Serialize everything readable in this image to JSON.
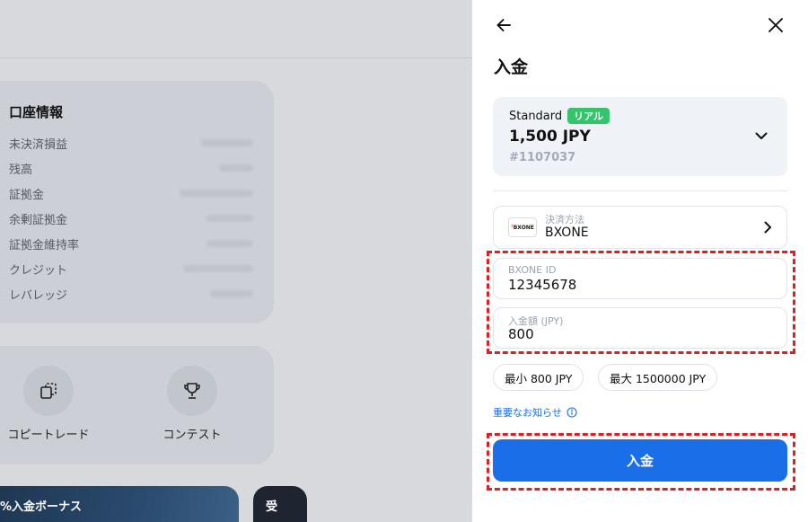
{
  "background": {
    "account_info": {
      "title": "口座情報",
      "rows": [
        {
          "label": "未決済損益"
        },
        {
          "label": "残高"
        },
        {
          "label": "証拠金"
        },
        {
          "label": "余剰証拠金"
        },
        {
          "label": "証拠金維持率"
        },
        {
          "label": "クレジット"
        },
        {
          "label": "レバレッジ"
        }
      ]
    },
    "tools": {
      "copy_trade": "コピートレード",
      "contest": "コンテスト"
    },
    "banner": {
      "text": "%入金ボーナス",
      "text2": "受"
    }
  },
  "panel": {
    "title": "入金",
    "account": {
      "type": "Standard",
      "tag": "リアル",
      "balance": "1,500 JPY",
      "number": "#1107037"
    },
    "method": {
      "label": "決済方法",
      "value": "BXONE",
      "logo_text": "BXONE"
    },
    "fields": {
      "bxone_id": {
        "label": "BXONE ID",
        "value": "12345678"
      },
      "amount": {
        "label": "入金額 (JPY)",
        "value": "800"
      }
    },
    "chips": {
      "min": "最小 800 JPY",
      "max": "最大 1500000 JPY"
    },
    "notice": "重要なお知らせ",
    "submit": "入金"
  },
  "colors": {
    "accent": "#1a6fe8",
    "tag_green": "#35c36b",
    "highlight": "#e02020"
  }
}
